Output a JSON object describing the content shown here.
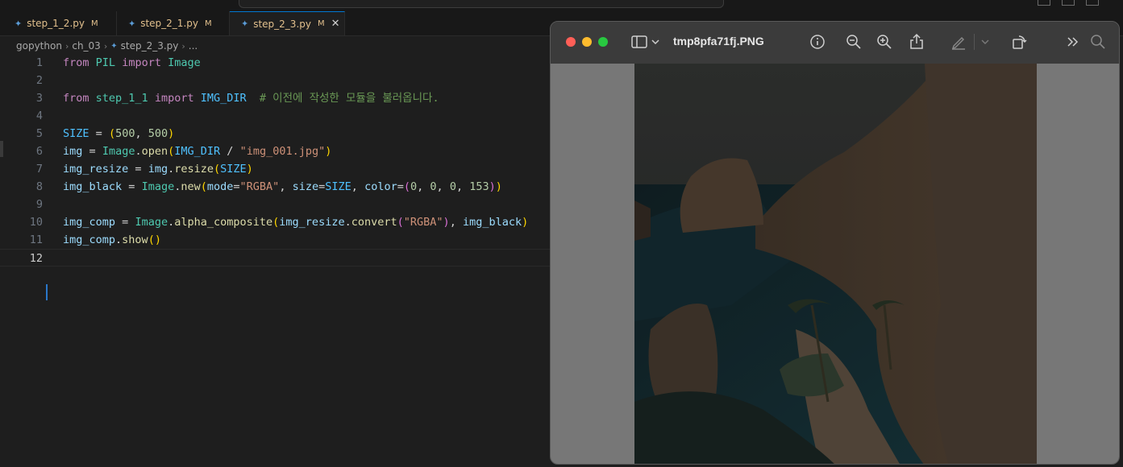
{
  "tabs": [
    {
      "label": "step_1_2.py",
      "modified": "M",
      "active": false
    },
    {
      "label": "step_2_1.py",
      "modified": "M",
      "active": false
    },
    {
      "label": "step_2_3.py",
      "modified": "M",
      "active": true
    }
  ],
  "breadcrumb": [
    "gopython",
    "ch_03",
    "step_2_3.py",
    "..."
  ],
  "editor": {
    "current_line": 12,
    "line_numbers": [
      "1",
      "2",
      "3",
      "4",
      "5",
      "6",
      "7",
      "8",
      "9",
      "10",
      "11",
      "12"
    ],
    "code": [
      "from PIL import Image",
      "",
      "from step_1_1 import IMG_DIR  # 이전에 작성한 모듈을 불러옵니다.",
      "",
      "SIZE = (500, 500)",
      "img = Image.open(IMG_DIR / \"img_001.jpg\")",
      "img_resize = img.resize(SIZE)",
      "img_black = Image.new(mode=\"RGBA\", size=SIZE, color=(0, 0, 0, 153))",
      "",
      "img_comp = Image.alpha_composite(img_resize.convert(\"RGBA\"), img_black)",
      "img_comp.show()",
      ""
    ]
  },
  "preview": {
    "title": "tmp8pfa71fj.PNG",
    "icons": [
      "sidebar-icon",
      "chevron-down-icon",
      "info-icon",
      "zoom-out-icon",
      "zoom-in-icon",
      "share-icon",
      "markup-pen-icon",
      "chevron-down-icon",
      "rotate-icon",
      "more-chevrons-icon",
      "search-icon"
    ],
    "image_alt": "dimmed photo of a rocky tropical coastline with palm trees"
  },
  "colors": {
    "editor_bg": "#1e1e1e",
    "tab_bar_bg": "#181818",
    "accent": "#0078d4",
    "traffic_red": "#ff5f57",
    "traffic_yellow": "#febc2e",
    "traffic_green": "#28c840"
  }
}
